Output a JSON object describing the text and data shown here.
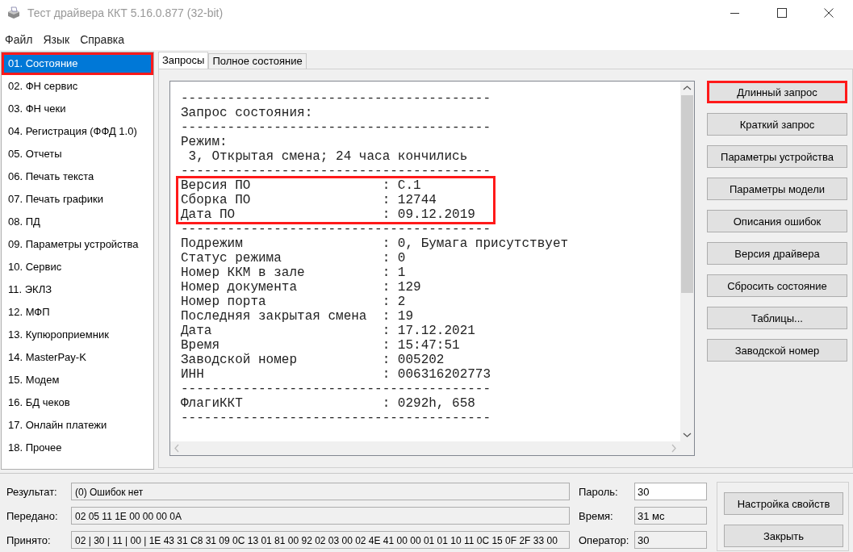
{
  "window": {
    "title": "Тест драйвера ККТ 5.16.0.877 (32-bit)"
  },
  "menu": [
    "Файл",
    "Язык",
    "Справка"
  ],
  "sidebar": {
    "items": [
      {
        "label": "01. Состояние",
        "selected": true,
        "highlighted": true
      },
      {
        "label": "02. ФН сервис",
        "selected": false,
        "highlighted": false
      },
      {
        "label": "03. ФН чеки",
        "selected": false,
        "highlighted": false
      },
      {
        "label": "04. Регистрация (ФФД 1.0)",
        "selected": false,
        "highlighted": false
      },
      {
        "label": "05. Отчеты",
        "selected": false,
        "highlighted": false
      },
      {
        "label": "06. Печать текста",
        "selected": false,
        "highlighted": false
      },
      {
        "label": "07. Печать графики",
        "selected": false,
        "highlighted": false
      },
      {
        "label": "08. ПД",
        "selected": false,
        "highlighted": false
      },
      {
        "label": "09. Параметры устройства",
        "selected": false,
        "highlighted": false
      },
      {
        "label": "10. Сервис",
        "selected": false,
        "highlighted": false
      },
      {
        "label": "11. ЭКЛЗ",
        "selected": false,
        "highlighted": false
      },
      {
        "label": "12. МФП",
        "selected": false,
        "highlighted": false
      },
      {
        "label": "13. Купюроприемник",
        "selected": false,
        "highlighted": false
      },
      {
        "label": "14. MasterPay-K",
        "selected": false,
        "highlighted": false
      },
      {
        "label": "15. Модем",
        "selected": false,
        "highlighted": false
      },
      {
        "label": "16. БД чеков",
        "selected": false,
        "highlighted": false
      },
      {
        "label": "17. Онлайн платежи",
        "selected": false,
        "highlighted": false
      },
      {
        "label": "18. Прочее",
        "selected": false,
        "highlighted": false
      }
    ]
  },
  "tabs": [
    {
      "label": "Запросы",
      "selected": true
    },
    {
      "label": "Полное состояние",
      "selected": false
    }
  ],
  "output": {
    "lines": [
      {
        "text": "----------------------------------------",
        "highlighted": false
      },
      {
        "text": "Запрос состояния:",
        "highlighted": false
      },
      {
        "text": "----------------------------------------",
        "highlighted": false
      },
      {
        "text": "Режим:",
        "highlighted": false
      },
      {
        "text": " 3, Открытая смена; 24 часа кончились",
        "highlighted": false
      },
      {
        "text": "----------------------------------------",
        "highlighted": false
      },
      {
        "text": "Версия ПО                 : C.1",
        "highlighted": true
      },
      {
        "text": "Сборка ПО                 : 12744",
        "highlighted": true
      },
      {
        "text": "Дата ПО                   : 09.12.2019",
        "highlighted": true
      },
      {
        "text": "----------------------------------------",
        "highlighted": false
      },
      {
        "text": "Подрежим                  : 0, Бумага присутствует",
        "highlighted": false
      },
      {
        "text": "Статус режима             : 0",
        "highlighted": false
      },
      {
        "text": "Номер ККМ в зале          : 1",
        "highlighted": false
      },
      {
        "text": "Номер документа           : 129",
        "highlighted": false
      },
      {
        "text": "Номер порта               : 2",
        "highlighted": false
      },
      {
        "text": "Последняя закрытая смена  : 19",
        "highlighted": false
      },
      {
        "text": "Дата                      : 17.12.2021",
        "highlighted": false
      },
      {
        "text": "Время                     : 15:47:51",
        "highlighted": false
      },
      {
        "text": "Заводской номер           : 005202",
        "highlighted": false
      },
      {
        "text": "ИНН                       : 006316202773",
        "highlighted": false
      },
      {
        "text": "----------------------------------------",
        "highlighted": false
      },
      {
        "text": "ФлагиККТ                  : 0292h, 658",
        "highlighted": false
      },
      {
        "text": "----------------------------------------",
        "highlighted": false
      }
    ]
  },
  "actions": [
    {
      "label": "Длинный запрос",
      "highlighted": true
    },
    {
      "label": "Краткий запрос",
      "highlighted": false
    },
    {
      "label": "Параметры устройства",
      "highlighted": false
    },
    {
      "label": "Параметры модели",
      "highlighted": false
    },
    {
      "label": "Описания ошибок",
      "highlighted": false
    },
    {
      "label": "Версия драйвера",
      "highlighted": false
    },
    {
      "label": "Сбросить состояние",
      "highlighted": false
    },
    {
      "label": "Таблицы...",
      "highlighted": false
    },
    {
      "label": "Заводской номер",
      "highlighted": false
    }
  ],
  "status": {
    "rows": [
      {
        "label": "Результат:",
        "value": "(0) Ошибок нет"
      },
      {
        "label": "Передано:",
        "value": "02 05 11 1E 00 00 00 0A"
      },
      {
        "label": "Принято:",
        "value": "02 | 30 | 11 | 00 | 1E 43 31 C8 31 09 0C 13 01 81 00 92 02 03 00 02 4E 41 00 00 01 01 10 11 0C 15 0F 2F 33 00"
      }
    ],
    "params": [
      {
        "label": "Пароль:",
        "value": "30",
        "kind": "input"
      },
      {
        "label": "Время:",
        "value": "31 мс",
        "kind": "readonly"
      },
      {
        "label": "Оператор:",
        "value": "30",
        "kind": "readonly"
      }
    ],
    "buttons": [
      "Настройка свойств",
      "Закрыть"
    ]
  }
}
